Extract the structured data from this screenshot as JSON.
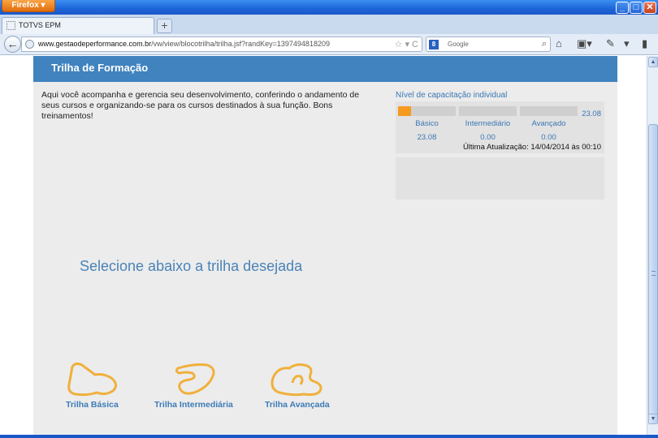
{
  "browser": {
    "app_button": "Firefox",
    "tab_title": "TOTVS EPM",
    "new_tab": "+",
    "url_host": "www.gestaodeperformance.com.br",
    "url_path": "/vw/view/blocotrilha/trilha.jsf?randKey=1397494818209",
    "search_placeholder": "Google",
    "window_controls": {
      "minimize": "_",
      "maximize": "□",
      "close": "✕"
    }
  },
  "header": {
    "title": "Trilha de Formação"
  },
  "intro_text": "Aqui você acompanha e gerencia seu desenvolvimento, conferindo o andamento de seus cursos e organizando-se para os cursos destinados à sua função. Bons treinamentos!",
  "nivel": {
    "title": "Nível de capacitação individual",
    "total": "23.08",
    "levels": [
      {
        "label": "Básico",
        "value": "23.08",
        "fill_pct": 23.08
      },
      {
        "label": "Intermediário",
        "value": "0.00",
        "fill_pct": 0
      },
      {
        "label": "Avançado",
        "value": "0.00",
        "fill_pct": 0
      }
    ],
    "updated": "Última Atualização: 14/04/2014 às 00:10"
  },
  "select_title": "Selecione abaixo a trilha desejada",
  "trails": [
    {
      "label": "Trilha Básica",
      "icon": "track-basic-icon"
    },
    {
      "label": "Trilha Intermediária",
      "icon": "track-intermediate-icon"
    },
    {
      "label": "Trilha Avançada",
      "icon": "track-advanced-icon"
    }
  ],
  "colors": {
    "accent": "#4083bf",
    "track": "#f0b03c",
    "progress": "#f59a1f"
  }
}
